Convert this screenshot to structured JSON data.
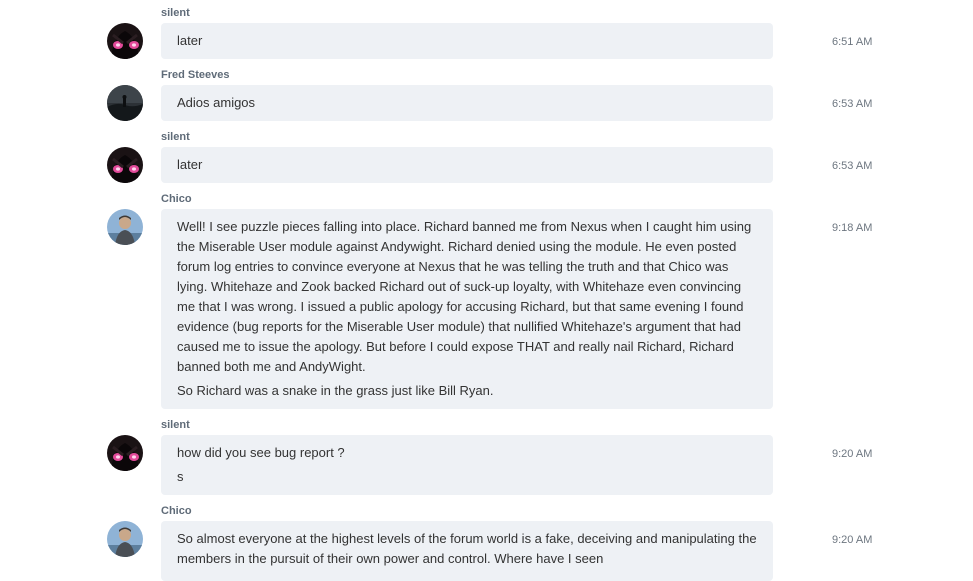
{
  "messages": [
    {
      "author": "silent",
      "time": "6:51 AM",
      "avatar": "anime-avatar",
      "paragraphs": [
        "later"
      ]
    },
    {
      "author": "Fred Steeves",
      "time": "6:53 AM",
      "avatar": "night-landscape-avatar",
      "paragraphs": [
        "Adios amigos"
      ]
    },
    {
      "author": "silent",
      "time": "6:53 AM",
      "avatar": "anime-avatar",
      "paragraphs": [
        "later"
      ]
    },
    {
      "author": "Chico",
      "time": "9:18 AM",
      "avatar": "man-photo-avatar",
      "paragraphs": [
        "Well!  I see puzzle pieces falling into place.  Richard banned me from Nexus when I caught him using the Miserable User module against Andywight.  Richard denied using the module.  He even posted forum log entries to convince everyone at Nexus that he was telling the truth and that Chico was lying.  Whitehaze and Zook backed Richard out of suck-up loyalty, with Whitehaze even convincing me that I was wrong.  I issued a public apology for accusing Richard, but that same evening I found evidence (bug reports for the Miserable User module) that nullified Whitehaze's argument that had caused me to issue the apology.  But before I could expose THAT and really nail Richard, Richard banned both me and AndyWight.",
        "So Richard was a snake in the grass just like Bill Ryan."
      ]
    },
    {
      "author": "silent",
      "time": "9:20 AM",
      "avatar": "anime-avatar",
      "paragraphs": [
        "how did you see bug report ?",
        "s"
      ]
    },
    {
      "author": "Chico",
      "time": "9:20 AM",
      "avatar": "man-photo-avatar",
      "paragraphs": [
        "So almost everyone at the highest levels of the forum world is a fake, deceiving and manipulating the members in the pursuit of their own power and control.  Where have I seen"
      ]
    }
  ]
}
